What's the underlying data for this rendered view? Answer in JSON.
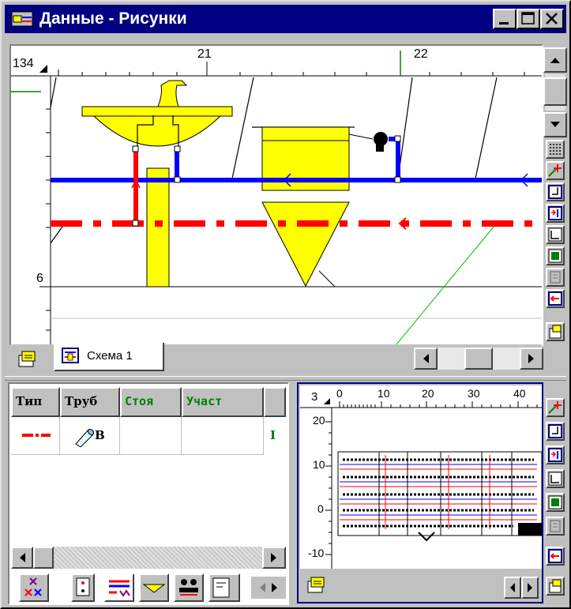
{
  "window": {
    "title": "Данные - Рисунки"
  },
  "drawing": {
    "corner_label": "134",
    "ruler_top_ticks": [
      "21",
      "22"
    ],
    "ruler_left_ticks": [
      "6"
    ],
    "tabs": [
      {
        "label": "Схема 1",
        "active": true
      }
    ]
  },
  "grid": {
    "columns": [
      "Тип",
      "Труб",
      "Стоя",
      "Участ"
    ],
    "row": {
      "pipe_label": "В",
      "overflow_text": "I"
    }
  },
  "preview": {
    "corner_label": "3",
    "x_ticks": [
      "0",
      "10",
      "20",
      "30",
      "40"
    ],
    "y_ticks": [
      "20",
      "10",
      "0",
      "-10"
    ]
  },
  "colors": {
    "titlebar": "#000080",
    "cold_pipe": "#0000ff",
    "hot_pipe": "#ff0000",
    "fixture": "#ffff00",
    "column_header_green": "#008000"
  },
  "icons": {
    "title": "drawing-app-icon",
    "minimize": "minimize-icon",
    "maximize": "maximize-icon",
    "close": "close-icon"
  }
}
